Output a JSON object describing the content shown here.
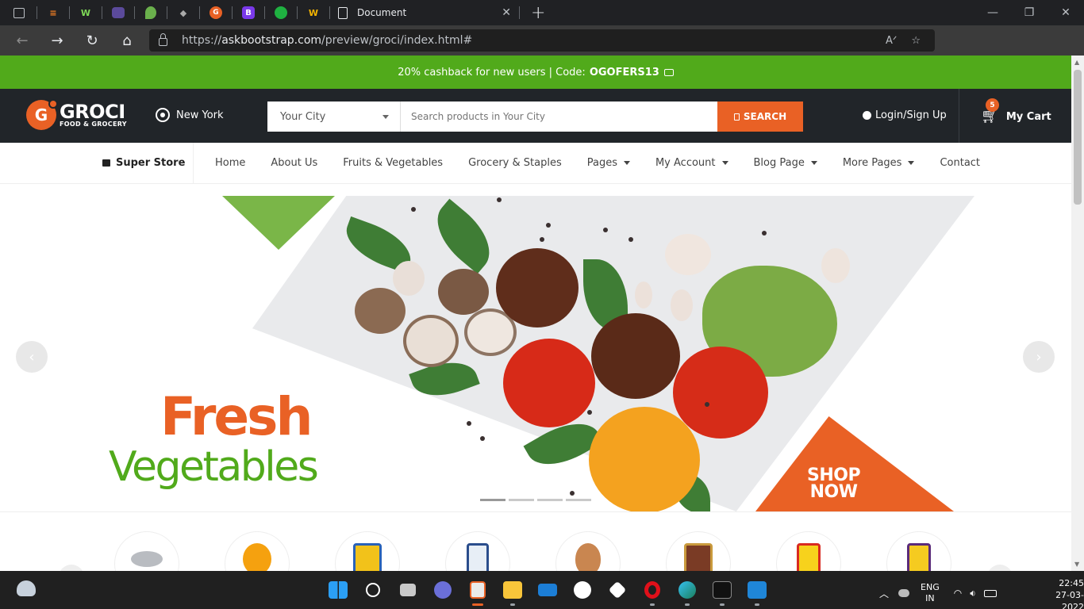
{
  "browser": {
    "tab_title": "Document",
    "url_scheme": "https://",
    "url_host": "askbootstrap.com",
    "url_path": "/preview/groci/index.html#"
  },
  "promo": {
    "text": "20% cashback for new users | Code:",
    "code": "OGOFERS13"
  },
  "header": {
    "logo_title": "GROCI",
    "logo_subtitle": "FOOD & GROCERY",
    "logo_letter": "G",
    "location": "New York",
    "city_select": "Your City",
    "search_placeholder": "Search products in Your City",
    "search_button": "SEARCH",
    "login": "Login/Sign Up",
    "cart_label": "My Cart",
    "cart_count": "5"
  },
  "menu": {
    "super_store": "Super Store",
    "items": [
      {
        "label": "Home"
      },
      {
        "label": "About Us"
      },
      {
        "label": "Fruits & Vegetables"
      },
      {
        "label": "Grocery & Staples"
      },
      {
        "label": "Pages"
      },
      {
        "label": "My Account"
      },
      {
        "label": "Blog Page"
      },
      {
        "label": "More Pages"
      },
      {
        "label": "Contact"
      }
    ]
  },
  "hero": {
    "line1": "Fresh",
    "line2": "Vegetables",
    "shop_line1": "SHOP",
    "shop_line2": "NOW",
    "slide_count": 4,
    "active_slide": 1
  },
  "taskbar": {
    "lang_top": "ENG",
    "lang_bottom": "IN",
    "time": "22:45",
    "date": "27-03-2022"
  },
  "colors": {
    "brand_orange": "#e96125",
    "brand_green": "#51aa1b",
    "header_dark": "#212529"
  }
}
